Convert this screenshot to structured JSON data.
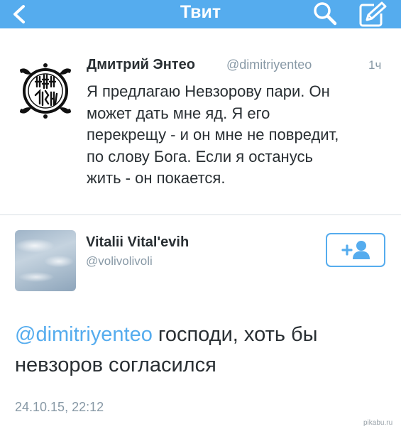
{
  "navbar": {
    "title": "Твит",
    "back_icon": "chevron-left-icon",
    "search_icon": "search-icon",
    "compose_icon": "compose-icon",
    "color": "#55acee"
  },
  "tweet": {
    "author_name": "Дмитрий Энтео",
    "author_handle": "@dimitriyenteo",
    "time": "1ч",
    "avatar_icon": "emblem-avatar",
    "text_lines": [
      "Я предлагаю Невзорову пари. Он",
      "может дать мне яд. Я его",
      "перекрещу - и он мне не повредит,",
      "по слову Бога. Если я останусь",
      "жить - он покается."
    ]
  },
  "reply": {
    "author_name": "Vitalii Vital'evih",
    "author_handle": "@volivolivoli",
    "avatar_icon": "sky-clouds-avatar",
    "follow_icon": "add-user-icon",
    "mention": "@dimitriyenteo",
    "text_rest": " господи, хоть бы",
    "text_line2": "невзоров согласился",
    "date": "24.10.15, 22:12"
  },
  "watermark": "pikabu.ru",
  "colors": {
    "accent": "#55acee",
    "text": "#292f33",
    "muted": "#8899a6",
    "divider": "#d7dfe5"
  }
}
